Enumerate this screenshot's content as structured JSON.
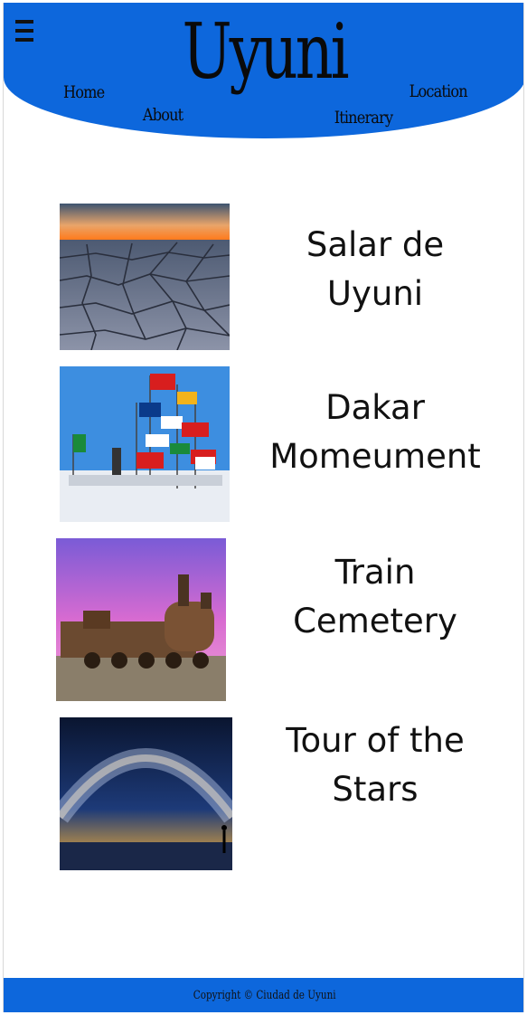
{
  "header": {
    "logo": "Uyuni",
    "nav": {
      "home": "Home",
      "about": "About",
      "itinerary": "Itinerary",
      "location": "Location"
    }
  },
  "attractions": [
    {
      "title_line1": "Salar de",
      "title_line2": "Uyuni"
    },
    {
      "title_line1": "Dakar",
      "title_line2": "Momeument"
    },
    {
      "title_line1": "Train",
      "title_line2": "Cemetery"
    },
    {
      "title_line1": "Tour of the",
      "title_line2": "Stars"
    }
  ],
  "footer": {
    "copyright": "Copyright © Ciudad de Uyuni"
  },
  "colors": {
    "brand_blue": "#0d67dc"
  }
}
